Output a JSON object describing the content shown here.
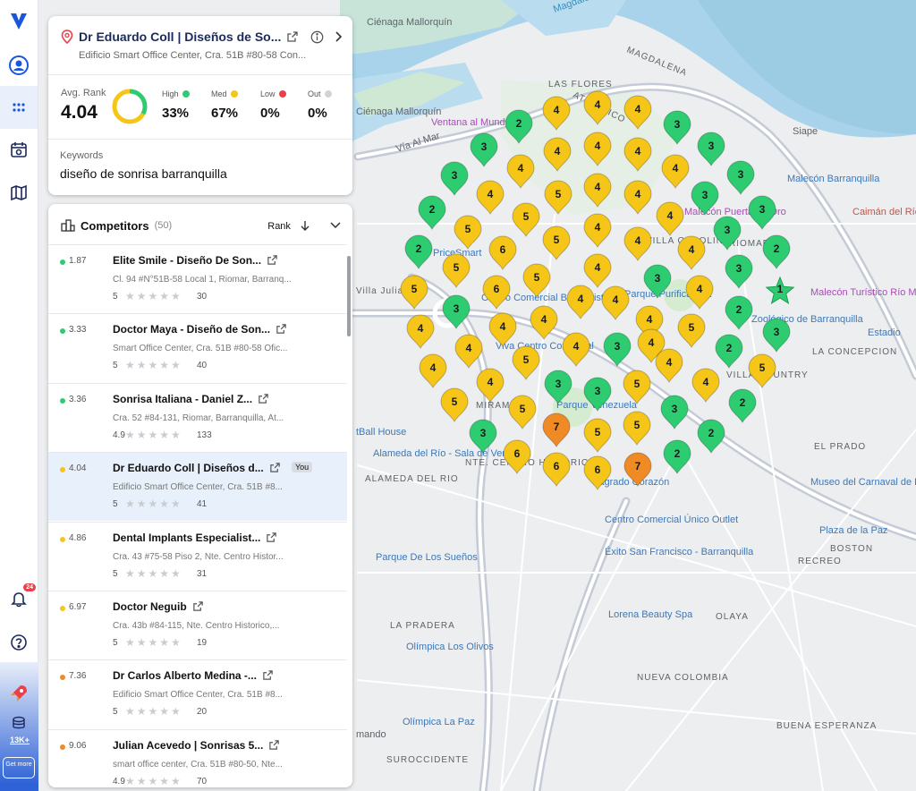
{
  "map": {
    "labels": [
      {
        "text": "Ciénaga Mallorquín",
        "kind": "place"
      },
      {
        "text": "Magdalena River",
        "kind": "water"
      },
      {
        "text": "MAGDALENA",
        "kind": "district"
      },
      {
        "text": "ATLANTICO",
        "kind": "district"
      },
      {
        "text": "LAS FLORES",
        "kind": "district"
      },
      {
        "text": "Ciénaga Mallorquín",
        "kind": "place"
      },
      {
        "text": "Ventana al Mundo",
        "kind": "poi"
      },
      {
        "text": "Vía Al Mar",
        "kind": "street"
      },
      {
        "text": "Siape",
        "kind": "place"
      },
      {
        "text": "Malecón Barranquilla",
        "kind": "poi"
      },
      {
        "text": "Malecón Puerta de Oro",
        "kind": "poi"
      },
      {
        "text": "Caimán del Río",
        "kind": "poi"
      },
      {
        "text": "VILLA CAROLINA",
        "kind": "district"
      },
      {
        "text": "RIOMAR",
        "kind": "district"
      },
      {
        "text": "PriceSmart",
        "kind": "poi"
      },
      {
        "text": "Villa Julia",
        "kind": "district"
      },
      {
        "text": "Centro Comercial Buenavista",
        "kind": "poi"
      },
      {
        "text": "Parque Purificadora",
        "kind": "poi"
      },
      {
        "text": "Malecón Turístico Río Magdalena Barranquilla",
        "kind": "poi"
      },
      {
        "text": "Zoológico de Barranquilla",
        "kind": "poi"
      },
      {
        "text": "Estadio",
        "kind": "poi"
      },
      {
        "text": "Viva Centro Comercial",
        "kind": "poi"
      },
      {
        "text": "LA CONCEPCION",
        "kind": "district"
      },
      {
        "text": "VILLA COUNTRY",
        "kind": "district"
      },
      {
        "text": "MIRAMAR",
        "kind": "district"
      },
      {
        "text": "Parque Venezuela",
        "kind": "poi"
      },
      {
        "text": "tBall House",
        "kind": "poi"
      },
      {
        "text": "Alameda del Río - Sala de Ventas",
        "kind": "poi"
      },
      {
        "text": "ALAMEDA DEL RIO",
        "kind": "district"
      },
      {
        "text": "NTE. CENTRO HISTORICO",
        "kind": "district"
      },
      {
        "text": "Sagrado Corazón",
        "kind": "poi"
      },
      {
        "text": "EL PRADO",
        "kind": "district"
      },
      {
        "text": "Museo del Carnaval de Barranquilla",
        "kind": "poi"
      },
      {
        "text": "Centro Comercial Único Outlet",
        "kind": "poi"
      },
      {
        "text": "Plaza de la Paz",
        "kind": "poi"
      },
      {
        "text": "BOSTON",
        "kind": "district"
      },
      {
        "text": "RECREO",
        "kind": "district"
      },
      {
        "text": "Parque De Los Sueños",
        "kind": "poi"
      },
      {
        "text": "Éxito San Francisco - Barranquilla",
        "kind": "poi"
      },
      {
        "text": "Lorena Beauty Spa",
        "kind": "poi"
      },
      {
        "text": "OLAYA",
        "kind": "district"
      },
      {
        "text": "LA PRADERA",
        "kind": "district"
      },
      {
        "text": "Olímpica Los Olivos",
        "kind": "poi"
      },
      {
        "text": "NUEVA COLOMBIA",
        "kind": "district"
      },
      {
        "text": "Olímpica La Paz",
        "kind": "poi"
      },
      {
        "text": "mando",
        "kind": "place"
      },
      {
        "text": "BUENA ESPERANZA",
        "kind": "district"
      },
      {
        "text": "SUROCCIDENTE",
        "kind": "district"
      }
    ],
    "pins": [
      "4",
      "4",
      "4",
      "3",
      "2",
      "3",
      "3",
      "4",
      "4",
      "4",
      "4",
      "3",
      "3",
      "4",
      "4",
      "5",
      "4",
      "4",
      "3",
      "3",
      "2",
      "4",
      "5",
      "5",
      "4",
      "4",
      "3",
      "2",
      "2",
      "5",
      "6",
      "5",
      "4",
      "4",
      "3",
      "3",
      "5",
      "5",
      "6",
      "4",
      "4",
      "4",
      "1",
      "3",
      "4",
      "4",
      "4",
      "4",
      "2",
      "4",
      "5",
      "4",
      "4",
      "3",
      "2",
      "3",
      "5",
      "4",
      "5",
      "4",
      "4",
      "3",
      "3",
      "5",
      "4",
      "5",
      "5",
      "2",
      "3",
      "3",
      "6",
      "6",
      "5",
      "2",
      "2",
      "6",
      "7",
      "7",
      "5",
      "6",
      "6",
      "6",
      "3"
    ]
  },
  "nav": {
    "badge": "24",
    "credits": "13K+",
    "get_more": "Get more"
  },
  "business": {
    "title": "Dr Eduardo Coll | Diseños de So...",
    "address": "Edificio Smart Office Center, Cra. 51B #80-58 Con...",
    "avg_rank_label": "Avg. Rank",
    "avg_rank": "4.04",
    "high_label": "High",
    "med_label": "Med",
    "low_label": "Low",
    "out_label": "Out",
    "high_pct": "33%",
    "med_pct": "67%",
    "low_pct": "0%",
    "out_pct": "0%",
    "high_fraction": 0.33,
    "med_fraction": 0.67,
    "keywords_label": "Keywords",
    "keyword": "diseño de sonrisa barranquilla"
  },
  "competitors": {
    "title": "Competitors",
    "count": "(50)",
    "sort_label": "Rank",
    "you_tag": "You",
    "rows": [
      {
        "rank": "1.87",
        "name": "Elite Smile - Diseño De Son...",
        "address": "Cl. 94 #N°51B-58 Local 1, Riomar, Barranq...",
        "rating": "5",
        "reviews": "30",
        "tier": "high"
      },
      {
        "rank": "3.33",
        "name": "Doctor Maya - Diseño de Son...",
        "address": "Smart Office Center, Cra. 51B #80-58 Ofic...",
        "rating": "5",
        "reviews": "40",
        "tier": "high"
      },
      {
        "rank": "3.36",
        "name": "Sonrisa Italiana - Daniel Z...",
        "address": "Cra. 52 #84-131, Riomar, Barranquilla, At...",
        "rating": "4.9",
        "reviews": "133",
        "tier": "high"
      },
      {
        "rank": "4.04",
        "name": "Dr Eduardo Coll | Diseños d...",
        "address": "Edificio Smart Office Center, Cra. 51B #8...",
        "rating": "5",
        "reviews": "41",
        "tier": "med",
        "you": true
      },
      {
        "rank": "4.86",
        "name": "Dental Implants Especialist...",
        "address": "Cra. 43 #75-58 Piso 2, Nte. Centro Histor...",
        "rating": "5",
        "reviews": "31",
        "tier": "med"
      },
      {
        "rank": "6.97",
        "name": "Doctor Neguib",
        "address": "Cra. 43b #84-115, Nte. Centro Historico,...",
        "rating": "5",
        "reviews": "19",
        "tier": "med"
      },
      {
        "rank": "7.36",
        "name": "Dr Carlos Alberto Medina -...",
        "address": "Edificio Smart Office Center, Cra. 51B #8...",
        "rating": "5",
        "reviews": "20",
        "tier": "low"
      },
      {
        "rank": "9.06",
        "name": "Julian Acevedo | Sonrisas 5...",
        "address": "smart office center, Cra. 51B #80-50, Nte...",
        "rating": "4.9",
        "reviews": "70",
        "tier": "low"
      }
    ]
  },
  "colors": {
    "high": "#2ecc71",
    "med": "#f5c518",
    "low": "#e8414b",
    "out": "#d0d3d8",
    "orange": "#f08a24",
    "accent": "#1a56db",
    "water": "#a9d3ea"
  }
}
